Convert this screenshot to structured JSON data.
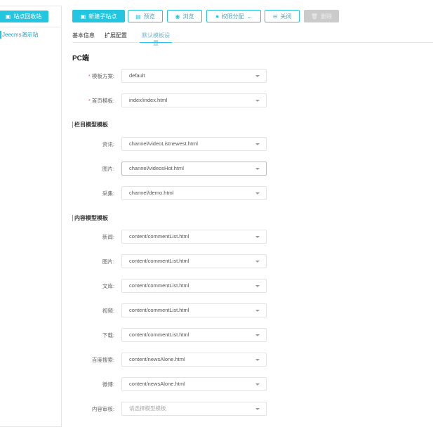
{
  "sidebar": {
    "recycle_label": "站点回收站",
    "site_name": "Jeecms演示站"
  },
  "toolbar": {
    "new_site": "新建子站点",
    "preview": "预览",
    "browse": "浏览",
    "permission": "权限分配",
    "close": "关闭",
    "delete": "删除"
  },
  "tabs": [
    "基本信息",
    "扩展配置",
    "默认模板设置"
  ],
  "pc_title": "PC端",
  "basic": [
    {
      "label": "模板方案:",
      "value": "default",
      "required": true
    },
    {
      "label": "首页模板:",
      "value": "index/index.html",
      "required": true
    }
  ],
  "channel_title": "栏目模型模板",
  "channel": [
    {
      "label": "资讯:",
      "value": "channel/videoListnewest.html"
    },
    {
      "label": "图片:",
      "value": "channel/videosHot.html"
    },
    {
      "label": "采集:",
      "value": "channel/demo.html"
    }
  ],
  "content_title": "内容模型模板",
  "content": [
    {
      "label": "新闻:",
      "value": "content/commentList.html"
    },
    {
      "label": "图片:",
      "value": "content/commentList.html"
    },
    {
      "label": "文库:",
      "value": "content/commentList.html"
    },
    {
      "label": "视频:",
      "value": "content/commentList.html"
    },
    {
      "label": "下载:",
      "value": "content/commentList.html"
    },
    {
      "label": "百度搜索:",
      "value": "content/newsAlone.html"
    },
    {
      "label": "微博:",
      "value": "content/newsAlone.html"
    },
    {
      "label": "内容审核:",
      "placeholder": "请选择模型模板"
    }
  ],
  "required_mark": "*"
}
